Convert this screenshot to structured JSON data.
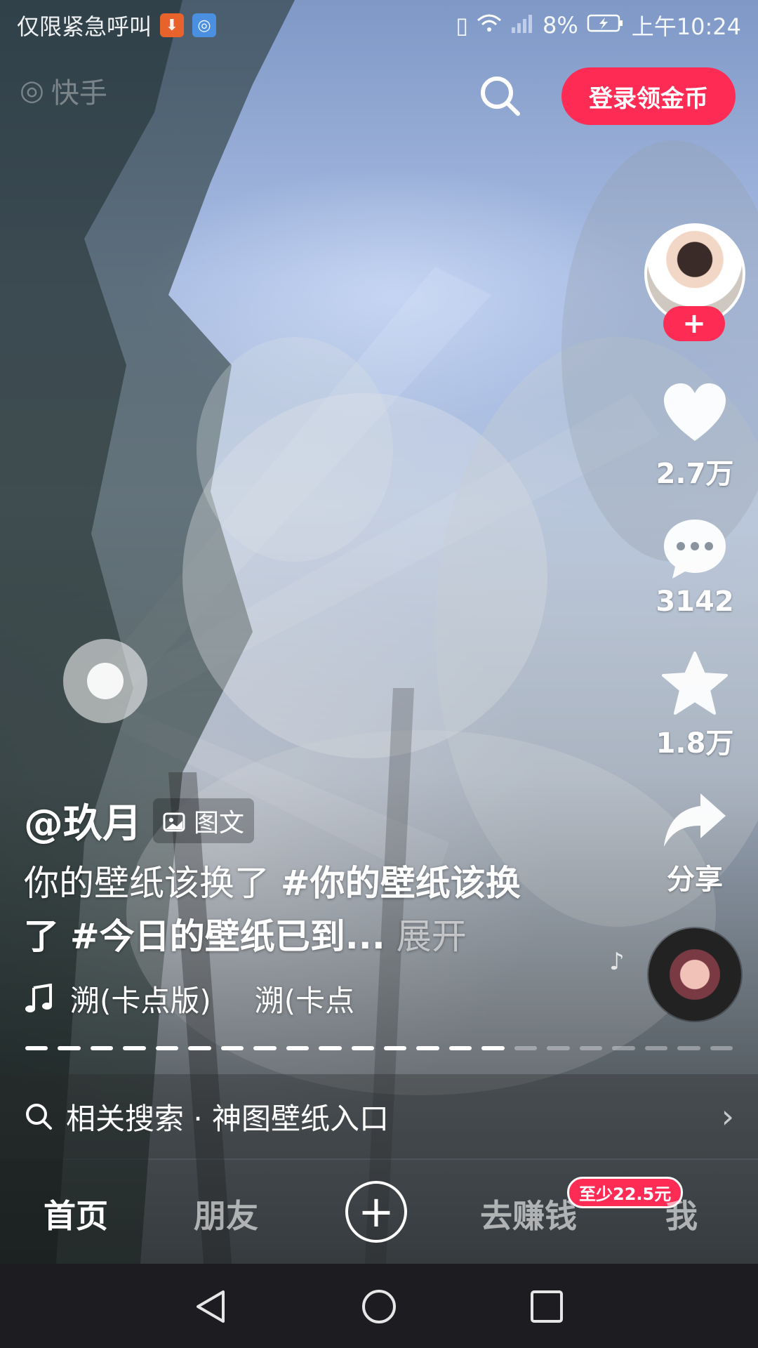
{
  "status_bar": {
    "carrier_text": "仅限紧急呼叫",
    "battery": "8%",
    "time": "上午10:24",
    "icons": [
      "download-icon",
      "vpn-icon",
      "vibrate-icon",
      "wifi-icon",
      "signal-icon",
      "battery-icon"
    ]
  },
  "top_bar": {
    "app_logo": "快手",
    "login_label": "登录领金币"
  },
  "creator": {
    "follow_label": "+"
  },
  "actions": {
    "likes": "2.7万",
    "comments": "3142",
    "favorites": "1.8万",
    "share_label": "分享"
  },
  "post": {
    "author": "@玖月",
    "type_label": "图文",
    "caption_plain": "你的壁纸该换了",
    "caption_tag_1": "#你的壁纸该换了",
    "caption_tag_2": "#今日的壁纸已到...",
    "expand_label": "展开"
  },
  "music": {
    "title_1": "溯(卡点版)",
    "title_2": "溯(卡点"
  },
  "progress": {
    "segments": 22,
    "active": 15
  },
  "related_search": {
    "label": "相关搜索 · 神图壁纸入口"
  },
  "bottom_nav": {
    "home": "首页",
    "friends": "朋友",
    "earn": "去赚钱",
    "earn_badge": "至少22.5元",
    "me": "我"
  },
  "colors": {
    "accent": "#fe2c55",
    "system_nav_bg": "#1c1c21"
  }
}
